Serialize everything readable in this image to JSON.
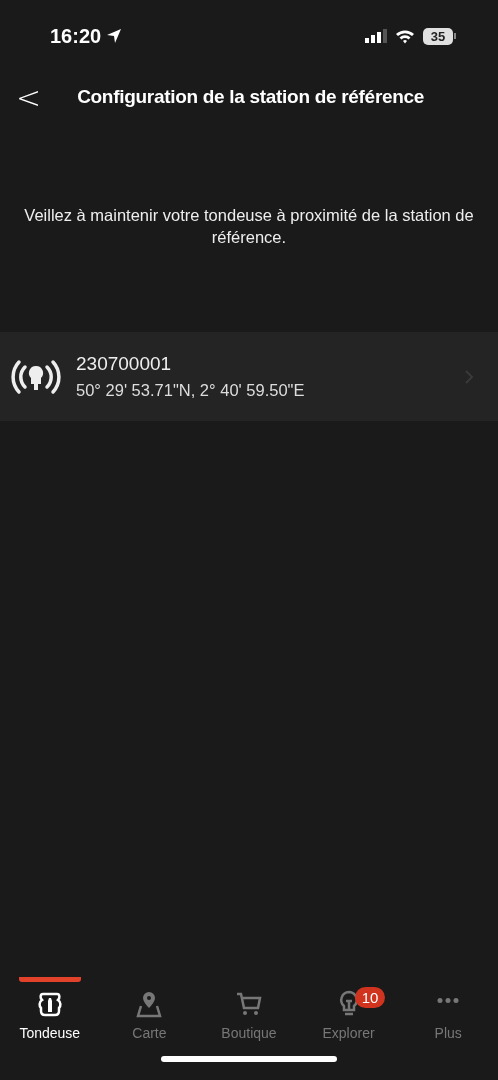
{
  "status_bar": {
    "time": "16:20",
    "battery": "35"
  },
  "header": {
    "back": "<",
    "title": "Configuration de la station de référence"
  },
  "message": "Veillez à maintenir votre tondeuse à proximité de la station de référence.",
  "stations": [
    {
      "id": "230700001",
      "coordinates": "50° 29' 53.71\"N, 2° 40' 59.50\"E"
    }
  ],
  "tabs": [
    {
      "kind": "mower",
      "label": "Tondeuse",
      "selected": true
    },
    {
      "kind": "map",
      "label": "Carte",
      "selected": false
    },
    {
      "kind": "cart",
      "label": "Boutique",
      "selected": false
    },
    {
      "kind": "bulb",
      "label": "Explorer",
      "selected": false,
      "badge": "10"
    },
    {
      "kind": "more",
      "label": "Plus",
      "selected": false
    }
  ]
}
